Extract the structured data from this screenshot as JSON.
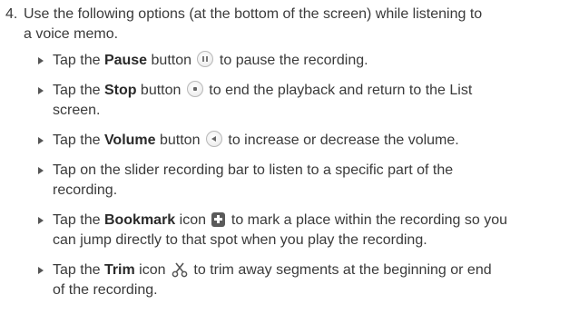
{
  "step": {
    "number": "4.",
    "line1": "Use the following options (at the bottom of the screen) while listening to",
    "line2": "a voice memo."
  },
  "bullets": [
    {
      "pre": "Tap the ",
      "bold": "Pause",
      "mid": " button ",
      "icon": "pause-icon",
      "post": " to pause the recording."
    },
    {
      "pre": "Tap the ",
      "bold": "Stop",
      "mid": " button ",
      "icon": "stop-icon",
      "post": " to end the playback and return to the List",
      "line2": "screen."
    },
    {
      "pre": "Tap the ",
      "bold": "Volume",
      "mid": " button ",
      "icon": "volume-icon",
      "post": " to increase or decrease the volume."
    },
    {
      "text": "Tap on the slider recording bar to listen to a specific part of the",
      "line2": "recording."
    },
    {
      "pre": "Tap the ",
      "bold": "Bookmark",
      "mid": " icon ",
      "icon": "bookmark-icon",
      "post": " to mark a place within the recording so you",
      "line2": "can jump directly to that spot when you play the recording."
    },
    {
      "pre": "Tap the ",
      "bold": "Trim",
      "mid": " icon ",
      "icon": "scissors-icon",
      "post": " to trim away segments at the beginning or end",
      "line2": "of the recording."
    }
  ]
}
